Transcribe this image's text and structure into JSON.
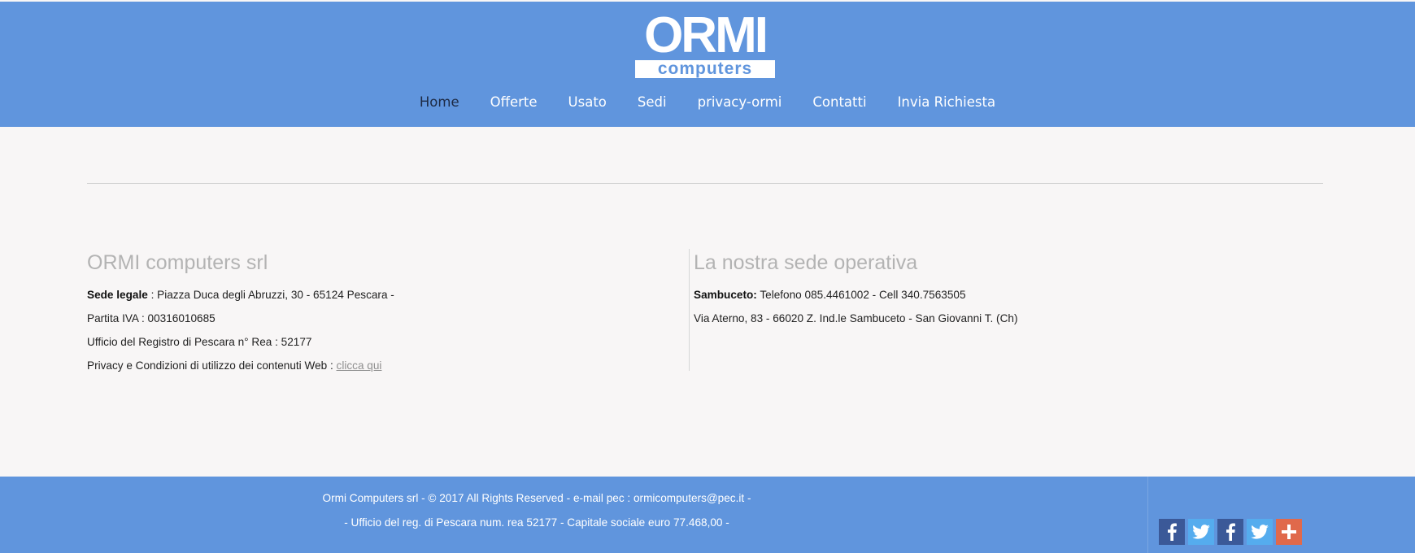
{
  "header": {
    "logo": {
      "main": "ORMI",
      "sub": "computers"
    },
    "nav": [
      {
        "label": "Home"
      },
      {
        "label": "Offerte"
      },
      {
        "label": "Usato"
      },
      {
        "label": "Sedi"
      },
      {
        "label": "privacy-ormi"
      },
      {
        "label": "Contatti"
      },
      {
        "label": "Invia Richiesta"
      }
    ]
  },
  "company": {
    "title": "ORMI computers srl",
    "sede_label": "Sede legale",
    "sede_value": " : Piazza Duca degli Abruzzi, 30 - 65124 Pescara -",
    "piva": "Partita IVA : 00316010685",
    "registro": "Ufficio del Registro di Pescara n° Rea : 52177",
    "privacy_text": "Privacy e Condizioni di utilizzo dei contenuti Web : ",
    "privacy_link": "clicca qui"
  },
  "operativa": {
    "title": "La nostra sede operativa",
    "name_label": "Sambuceto:",
    "phones": " Telefono 085.4461002  -  Cell 340.7563505",
    "address": "Via Aterno, 83 - 66020 Z. Ind.le Sambuceto - San Giovanni T. (Ch)"
  },
  "footer": {
    "line1": "Ormi Computers srl - © 2017 All Rights Reserved - e-mail pec : ormicomputers@pec.it -",
    "line2": "- Ufficio del reg. di Pescara num. rea 52177 - Capitale sociale euro 77.468,00 -"
  },
  "social": [
    {
      "icon": "facebook-icon",
      "color": "#3b5998"
    },
    {
      "icon": "twitter-icon",
      "color": "#55acee"
    },
    {
      "icon": "facebook-icon",
      "color": "#3b5998"
    },
    {
      "icon": "twitter-icon",
      "color": "#55acee"
    },
    {
      "icon": "plus-icon",
      "color": "#e0694b"
    }
  ],
  "colors": {
    "brand_blue": "#6095dd",
    "page_bg": "#f8f6f6",
    "heading_gray": "#b3b3b3"
  }
}
